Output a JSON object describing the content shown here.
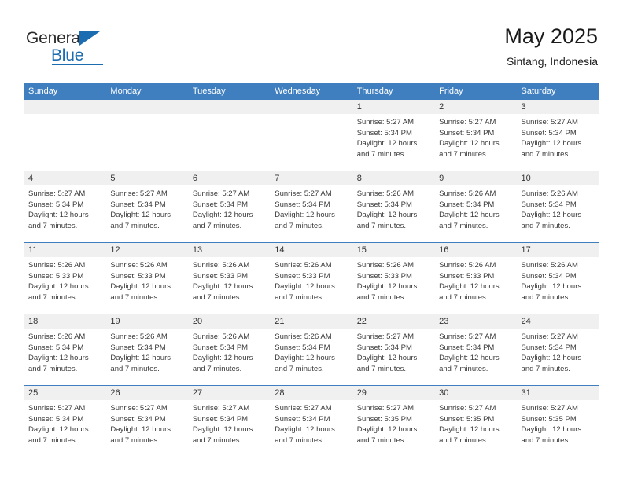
{
  "brand": {
    "name_top": "General",
    "name_bottom": "Blue"
  },
  "header": {
    "title": "May 2025",
    "subtitle": "Sintang, Indonesia"
  },
  "colors": {
    "header_bar": "#3f7fbf",
    "brand_blue": "#1b6cb0",
    "daynum_band": "#f0f0f0",
    "row_divider": "#3f7fbf",
    "text": "#3a3a3a"
  },
  "labels": {
    "sunrise_prefix": "Sunrise:",
    "sunset_prefix": "Sunset:",
    "daylight_prefix": "Daylight:"
  },
  "weekday_headers": [
    "Sunday",
    "Monday",
    "Tuesday",
    "Wednesday",
    "Thursday",
    "Friday",
    "Saturday"
  ],
  "weeks": [
    [
      {
        "day": "",
        "empty": true,
        "sunrise": "",
        "sunset": "",
        "daylight_line1": "",
        "daylight_line2": ""
      },
      {
        "day": "",
        "empty": true,
        "sunrise": "",
        "sunset": "",
        "daylight_line1": "",
        "daylight_line2": ""
      },
      {
        "day": "",
        "empty": true,
        "sunrise": "",
        "sunset": "",
        "daylight_line1": "",
        "daylight_line2": ""
      },
      {
        "day": "",
        "empty": true,
        "sunrise": "",
        "sunset": "",
        "daylight_line1": "",
        "daylight_line2": ""
      },
      {
        "day": "1",
        "empty": false,
        "sunrise": "Sunrise: 5:27 AM",
        "sunset": "Sunset: 5:34 PM",
        "daylight_line1": "Daylight: 12 hours",
        "daylight_line2": "and 7 minutes."
      },
      {
        "day": "2",
        "empty": false,
        "sunrise": "Sunrise: 5:27 AM",
        "sunset": "Sunset: 5:34 PM",
        "daylight_line1": "Daylight: 12 hours",
        "daylight_line2": "and 7 minutes."
      },
      {
        "day": "3",
        "empty": false,
        "sunrise": "Sunrise: 5:27 AM",
        "sunset": "Sunset: 5:34 PM",
        "daylight_line1": "Daylight: 12 hours",
        "daylight_line2": "and 7 minutes."
      }
    ],
    [
      {
        "day": "4",
        "empty": false,
        "sunrise": "Sunrise: 5:27 AM",
        "sunset": "Sunset: 5:34 PM",
        "daylight_line1": "Daylight: 12 hours",
        "daylight_line2": "and 7 minutes."
      },
      {
        "day": "5",
        "empty": false,
        "sunrise": "Sunrise: 5:27 AM",
        "sunset": "Sunset: 5:34 PM",
        "daylight_line1": "Daylight: 12 hours",
        "daylight_line2": "and 7 minutes."
      },
      {
        "day": "6",
        "empty": false,
        "sunrise": "Sunrise: 5:27 AM",
        "sunset": "Sunset: 5:34 PM",
        "daylight_line1": "Daylight: 12 hours",
        "daylight_line2": "and 7 minutes."
      },
      {
        "day": "7",
        "empty": false,
        "sunrise": "Sunrise: 5:27 AM",
        "sunset": "Sunset: 5:34 PM",
        "daylight_line1": "Daylight: 12 hours",
        "daylight_line2": "and 7 minutes."
      },
      {
        "day": "8",
        "empty": false,
        "sunrise": "Sunrise: 5:26 AM",
        "sunset": "Sunset: 5:34 PM",
        "daylight_line1": "Daylight: 12 hours",
        "daylight_line2": "and 7 minutes."
      },
      {
        "day": "9",
        "empty": false,
        "sunrise": "Sunrise: 5:26 AM",
        "sunset": "Sunset: 5:34 PM",
        "daylight_line1": "Daylight: 12 hours",
        "daylight_line2": "and 7 minutes."
      },
      {
        "day": "10",
        "empty": false,
        "sunrise": "Sunrise: 5:26 AM",
        "sunset": "Sunset: 5:34 PM",
        "daylight_line1": "Daylight: 12 hours",
        "daylight_line2": "and 7 minutes."
      }
    ],
    [
      {
        "day": "11",
        "empty": false,
        "sunrise": "Sunrise: 5:26 AM",
        "sunset": "Sunset: 5:33 PM",
        "daylight_line1": "Daylight: 12 hours",
        "daylight_line2": "and 7 minutes."
      },
      {
        "day": "12",
        "empty": false,
        "sunrise": "Sunrise: 5:26 AM",
        "sunset": "Sunset: 5:33 PM",
        "daylight_line1": "Daylight: 12 hours",
        "daylight_line2": "and 7 minutes."
      },
      {
        "day": "13",
        "empty": false,
        "sunrise": "Sunrise: 5:26 AM",
        "sunset": "Sunset: 5:33 PM",
        "daylight_line1": "Daylight: 12 hours",
        "daylight_line2": "and 7 minutes."
      },
      {
        "day": "14",
        "empty": false,
        "sunrise": "Sunrise: 5:26 AM",
        "sunset": "Sunset: 5:33 PM",
        "daylight_line1": "Daylight: 12 hours",
        "daylight_line2": "and 7 minutes."
      },
      {
        "day": "15",
        "empty": false,
        "sunrise": "Sunrise: 5:26 AM",
        "sunset": "Sunset: 5:33 PM",
        "daylight_line1": "Daylight: 12 hours",
        "daylight_line2": "and 7 minutes."
      },
      {
        "day": "16",
        "empty": false,
        "sunrise": "Sunrise: 5:26 AM",
        "sunset": "Sunset: 5:33 PM",
        "daylight_line1": "Daylight: 12 hours",
        "daylight_line2": "and 7 minutes."
      },
      {
        "day": "17",
        "empty": false,
        "sunrise": "Sunrise: 5:26 AM",
        "sunset": "Sunset: 5:34 PM",
        "daylight_line1": "Daylight: 12 hours",
        "daylight_line2": "and 7 minutes."
      }
    ],
    [
      {
        "day": "18",
        "empty": false,
        "sunrise": "Sunrise: 5:26 AM",
        "sunset": "Sunset: 5:34 PM",
        "daylight_line1": "Daylight: 12 hours",
        "daylight_line2": "and 7 minutes."
      },
      {
        "day": "19",
        "empty": false,
        "sunrise": "Sunrise: 5:26 AM",
        "sunset": "Sunset: 5:34 PM",
        "daylight_line1": "Daylight: 12 hours",
        "daylight_line2": "and 7 minutes."
      },
      {
        "day": "20",
        "empty": false,
        "sunrise": "Sunrise: 5:26 AM",
        "sunset": "Sunset: 5:34 PM",
        "daylight_line1": "Daylight: 12 hours",
        "daylight_line2": "and 7 minutes."
      },
      {
        "day": "21",
        "empty": false,
        "sunrise": "Sunrise: 5:26 AM",
        "sunset": "Sunset: 5:34 PM",
        "daylight_line1": "Daylight: 12 hours",
        "daylight_line2": "and 7 minutes."
      },
      {
        "day": "22",
        "empty": false,
        "sunrise": "Sunrise: 5:27 AM",
        "sunset": "Sunset: 5:34 PM",
        "daylight_line1": "Daylight: 12 hours",
        "daylight_line2": "and 7 minutes."
      },
      {
        "day": "23",
        "empty": false,
        "sunrise": "Sunrise: 5:27 AM",
        "sunset": "Sunset: 5:34 PM",
        "daylight_line1": "Daylight: 12 hours",
        "daylight_line2": "and 7 minutes."
      },
      {
        "day": "24",
        "empty": false,
        "sunrise": "Sunrise: 5:27 AM",
        "sunset": "Sunset: 5:34 PM",
        "daylight_line1": "Daylight: 12 hours",
        "daylight_line2": "and 7 minutes."
      }
    ],
    [
      {
        "day": "25",
        "empty": false,
        "sunrise": "Sunrise: 5:27 AM",
        "sunset": "Sunset: 5:34 PM",
        "daylight_line1": "Daylight: 12 hours",
        "daylight_line2": "and 7 minutes."
      },
      {
        "day": "26",
        "empty": false,
        "sunrise": "Sunrise: 5:27 AM",
        "sunset": "Sunset: 5:34 PM",
        "daylight_line1": "Daylight: 12 hours",
        "daylight_line2": "and 7 minutes."
      },
      {
        "day": "27",
        "empty": false,
        "sunrise": "Sunrise: 5:27 AM",
        "sunset": "Sunset: 5:34 PM",
        "daylight_line1": "Daylight: 12 hours",
        "daylight_line2": "and 7 minutes."
      },
      {
        "day": "28",
        "empty": false,
        "sunrise": "Sunrise: 5:27 AM",
        "sunset": "Sunset: 5:34 PM",
        "daylight_line1": "Daylight: 12 hours",
        "daylight_line2": "and 7 minutes."
      },
      {
        "day": "29",
        "empty": false,
        "sunrise": "Sunrise: 5:27 AM",
        "sunset": "Sunset: 5:35 PM",
        "daylight_line1": "Daylight: 12 hours",
        "daylight_line2": "and 7 minutes."
      },
      {
        "day": "30",
        "empty": false,
        "sunrise": "Sunrise: 5:27 AM",
        "sunset": "Sunset: 5:35 PM",
        "daylight_line1": "Daylight: 12 hours",
        "daylight_line2": "and 7 minutes."
      },
      {
        "day": "31",
        "empty": false,
        "sunrise": "Sunrise: 5:27 AM",
        "sunset": "Sunset: 5:35 PM",
        "daylight_line1": "Daylight: 12 hours",
        "daylight_line2": "and 7 minutes."
      }
    ]
  ]
}
